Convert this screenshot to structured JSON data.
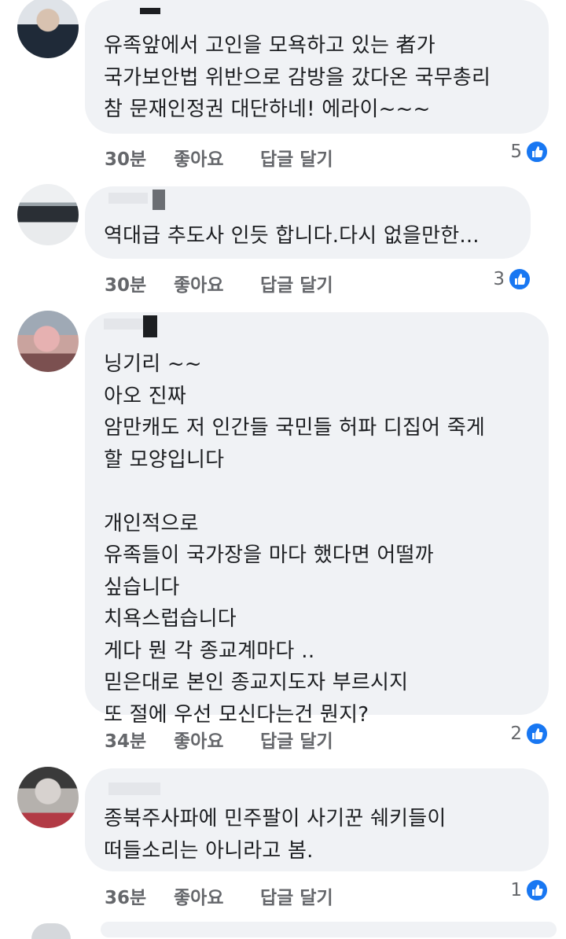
{
  "colors": {
    "bubble": "#f0f2f5",
    "meta_text": "#65676b",
    "body_text": "#1c1e21",
    "like_blue": "#1877f2"
  },
  "comments": [
    {
      "text": "유족앞에서 고인을 모욕하고 있는 者가\n국가보안법 위반으로 감방을 갔다온 국무총리\n참 문재인정권 대단하네! 에라이~~~",
      "time": "30분",
      "like_label": "좋아요",
      "reply_label": "답글 달기",
      "reaction_count": "5"
    },
    {
      "text": "역대급 추도사 인듯 합니다.다시 없을만한...",
      "time": "30분",
      "like_label": "좋아요",
      "reply_label": "답글 달기",
      "reaction_count": "3"
    },
    {
      "text": "닝기리 ~~\n아오 진짜\n암만캐도 저 인간들 국민들 허파 디집어 죽게\n할 모양입니다\n\n개인적으로\n유족들이 국가장을 마다 했다면 어떨까\n싶습니다\n치욕스럽습니다\n게다 뭔 각 종교계마다 ‥\n믿은대로 본인 종교지도자 부르시지\n또 절에 우선 모신다는건 뭔지?",
      "time": "34분",
      "like_label": "좋아요",
      "reply_label": "답글 달기",
      "reaction_count": "2"
    },
    {
      "text": "종북주사파에 민주팔이 사기꾼 쉐키들이\n떠들소리는 아니라고 봄.",
      "time": "36분",
      "like_label": "좋아요",
      "reply_label": "답글 달기",
      "reaction_count": "1"
    }
  ]
}
